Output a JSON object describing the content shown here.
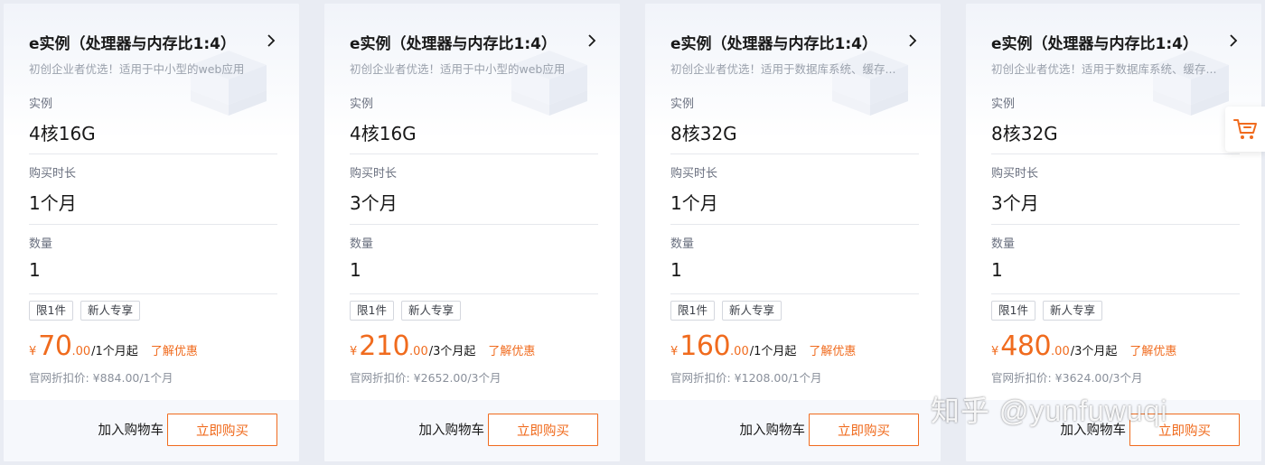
{
  "cards": [
    {
      "title": "e实例（处理器与内存比1:4）",
      "subtitle": "初创企业者优选！适用于中小型的web应用",
      "instance_label": "实例",
      "instance_value": "4核16G",
      "duration_label": "购买时长",
      "duration_value": "1个月",
      "quantity_label": "数量",
      "quantity_value": "1",
      "tags": [
        "限1件",
        "新人专享"
      ],
      "currency": "¥",
      "price_int": "70",
      "price_dec": ".00",
      "price_unit": "/1个月起",
      "learn_more": "了解优惠",
      "original_price": "官网折扣价: ¥884.00/1个月",
      "add_to_cart": "加入购物车",
      "buy_now": "立即购买"
    },
    {
      "title": "e实例（处理器与内存比1:4）",
      "subtitle": "初创企业者优选！适用于中小型的web应用",
      "instance_label": "实例",
      "instance_value": "4核16G",
      "duration_label": "购买时长",
      "duration_value": "3个月",
      "quantity_label": "数量",
      "quantity_value": "1",
      "tags": [
        "限1件",
        "新人专享"
      ],
      "currency": "¥",
      "price_int": "210",
      "price_dec": ".00",
      "price_unit": "/3个月起",
      "learn_more": "了解优惠",
      "original_price": "官网折扣价: ¥2652.00/3个月",
      "add_to_cart": "加入购物车",
      "buy_now": "立即购买"
    },
    {
      "title": "e实例（处理器与内存比1:4）",
      "subtitle": "初创企业者优选！适用于数据库系统、缓存...",
      "instance_label": "实例",
      "instance_value": "8核32G",
      "duration_label": "购买时长",
      "duration_value": "1个月",
      "quantity_label": "数量",
      "quantity_value": "1",
      "tags": [
        "限1件",
        "新人专享"
      ],
      "currency": "¥",
      "price_int": "160",
      "price_dec": ".00",
      "price_unit": "/1个月起",
      "learn_more": "了解优惠",
      "original_price": "官网折扣价: ¥1208.00/1个月",
      "add_to_cart": "加入购物车",
      "buy_now": "立即购买"
    },
    {
      "title": "e实例（处理器与内存比1:4）",
      "subtitle": "初创企业者优选！适用于数据库系统、缓存...",
      "instance_label": "实例",
      "instance_value": "8核32G",
      "duration_label": "购买时长",
      "duration_value": "3个月",
      "quantity_label": "数量",
      "quantity_value": "1",
      "tags": [
        "限1件",
        "新人专享"
      ],
      "currency": "¥",
      "price_int": "480",
      "price_dec": ".00",
      "price_unit": "/3个月起",
      "learn_more": "了解优惠",
      "original_price": "官网折扣价: ¥3624.00/3个月",
      "add_to_cart": "加入购物车",
      "buy_now": "立即购买"
    }
  ],
  "floating_cart": {
    "icon": "cart-icon"
  },
  "watermark": {
    "text": "知乎 @yunfuwuqi"
  },
  "colors": {
    "accent": "#f06b1e",
    "background": "#e9ecf3",
    "card": "#ffffff",
    "text_primary": "#181818",
    "text_secondary": "#9aa1ac"
  }
}
